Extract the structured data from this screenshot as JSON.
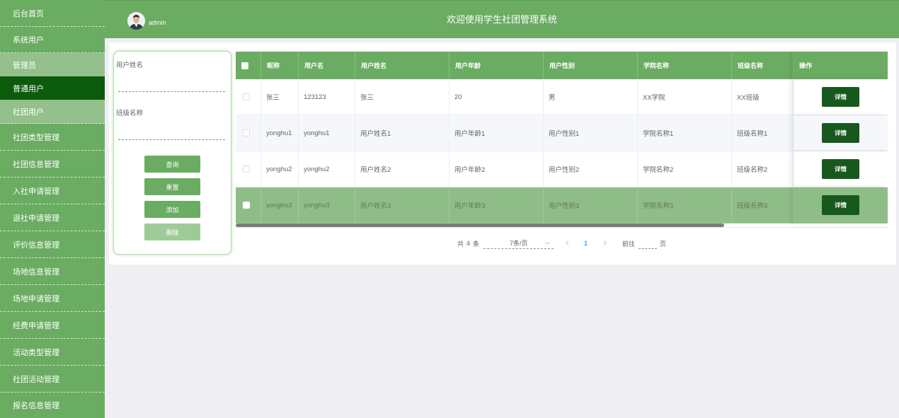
{
  "theme": {
    "primary": "#6aac62",
    "sidebar_light": "#93c08b",
    "sidebar_active": "#0c5a0c",
    "button_dark": "#17591c",
    "button_disabled": "#9fcb98",
    "row_highlight": "#8fbd87",
    "row_stripe": "#f5f7fa",
    "page_bg": "#efeff3",
    "link_blue": "#409eff",
    "text": "#606266"
  },
  "header": {
    "username": "admin",
    "title": "欢迎使用学生社团管理系统"
  },
  "sidebar": {
    "items": [
      {
        "label": "后台首页"
      },
      {
        "label": "系统用户",
        "expanded": true,
        "children": [
          {
            "label": "管理员"
          },
          {
            "label": "普通用户",
            "active": true
          },
          {
            "label": "社团用户"
          }
        ]
      },
      {
        "label": "社团类型管理"
      },
      {
        "label": "社团信息管理"
      },
      {
        "label": "入社申请管理"
      },
      {
        "label": "退社申请管理"
      },
      {
        "label": "评价信息管理"
      },
      {
        "label": "场地信息管理"
      },
      {
        "label": "场地申请管理"
      },
      {
        "label": "经费申请管理"
      },
      {
        "label": "活动类型管理"
      },
      {
        "label": "社团活动管理"
      },
      {
        "label": "报名信息管理"
      }
    ]
  },
  "search": {
    "fields": [
      {
        "label": "用户姓名",
        "value": ""
      },
      {
        "label": "班级名称",
        "value": ""
      }
    ],
    "buttons": {
      "query": {
        "label": "查询"
      },
      "reset": {
        "label": "重置"
      },
      "add": {
        "label": "添加"
      },
      "delete": {
        "label": "删除",
        "disabled": true
      }
    }
  },
  "table": {
    "columns": [
      "昵称",
      "用户名",
      "用户姓名",
      "用户年龄",
      "用户性别",
      "学院名称",
      "班级名称",
      "操作"
    ],
    "action_label": "详情",
    "rows": [
      {
        "nickname": "张三",
        "username": "123123",
        "name": "张三",
        "age": "20",
        "gender": "男",
        "college": "XX学院",
        "class_name": "XX班级"
      },
      {
        "nickname": "yonghu1",
        "username": "yonghu1",
        "name": "用户姓名1",
        "age": "用户年龄1",
        "gender": "用户性别1",
        "college": "学院名称1",
        "class_name": "班级名称1"
      },
      {
        "nickname": "yonghu2",
        "username": "yonghu2",
        "name": "用户姓名2",
        "age": "用户年龄2",
        "gender": "用户性别2",
        "college": "学院名称2",
        "class_name": "班级名称2"
      },
      {
        "nickname": "yonghu3",
        "username": "yonghu3",
        "name": "用户姓名3",
        "age": "用户年龄3",
        "gender": "用户性别3",
        "college": "学院名称3",
        "class_name": "班级名称3",
        "highlighted": true
      }
    ]
  },
  "pagination": {
    "total_prefix": "共",
    "total": 4,
    "total_suffix": "条",
    "page_size_label": "7条/页",
    "current_page": 1,
    "goto_label": "前往",
    "goto_value": "",
    "page_unit": "页"
  }
}
